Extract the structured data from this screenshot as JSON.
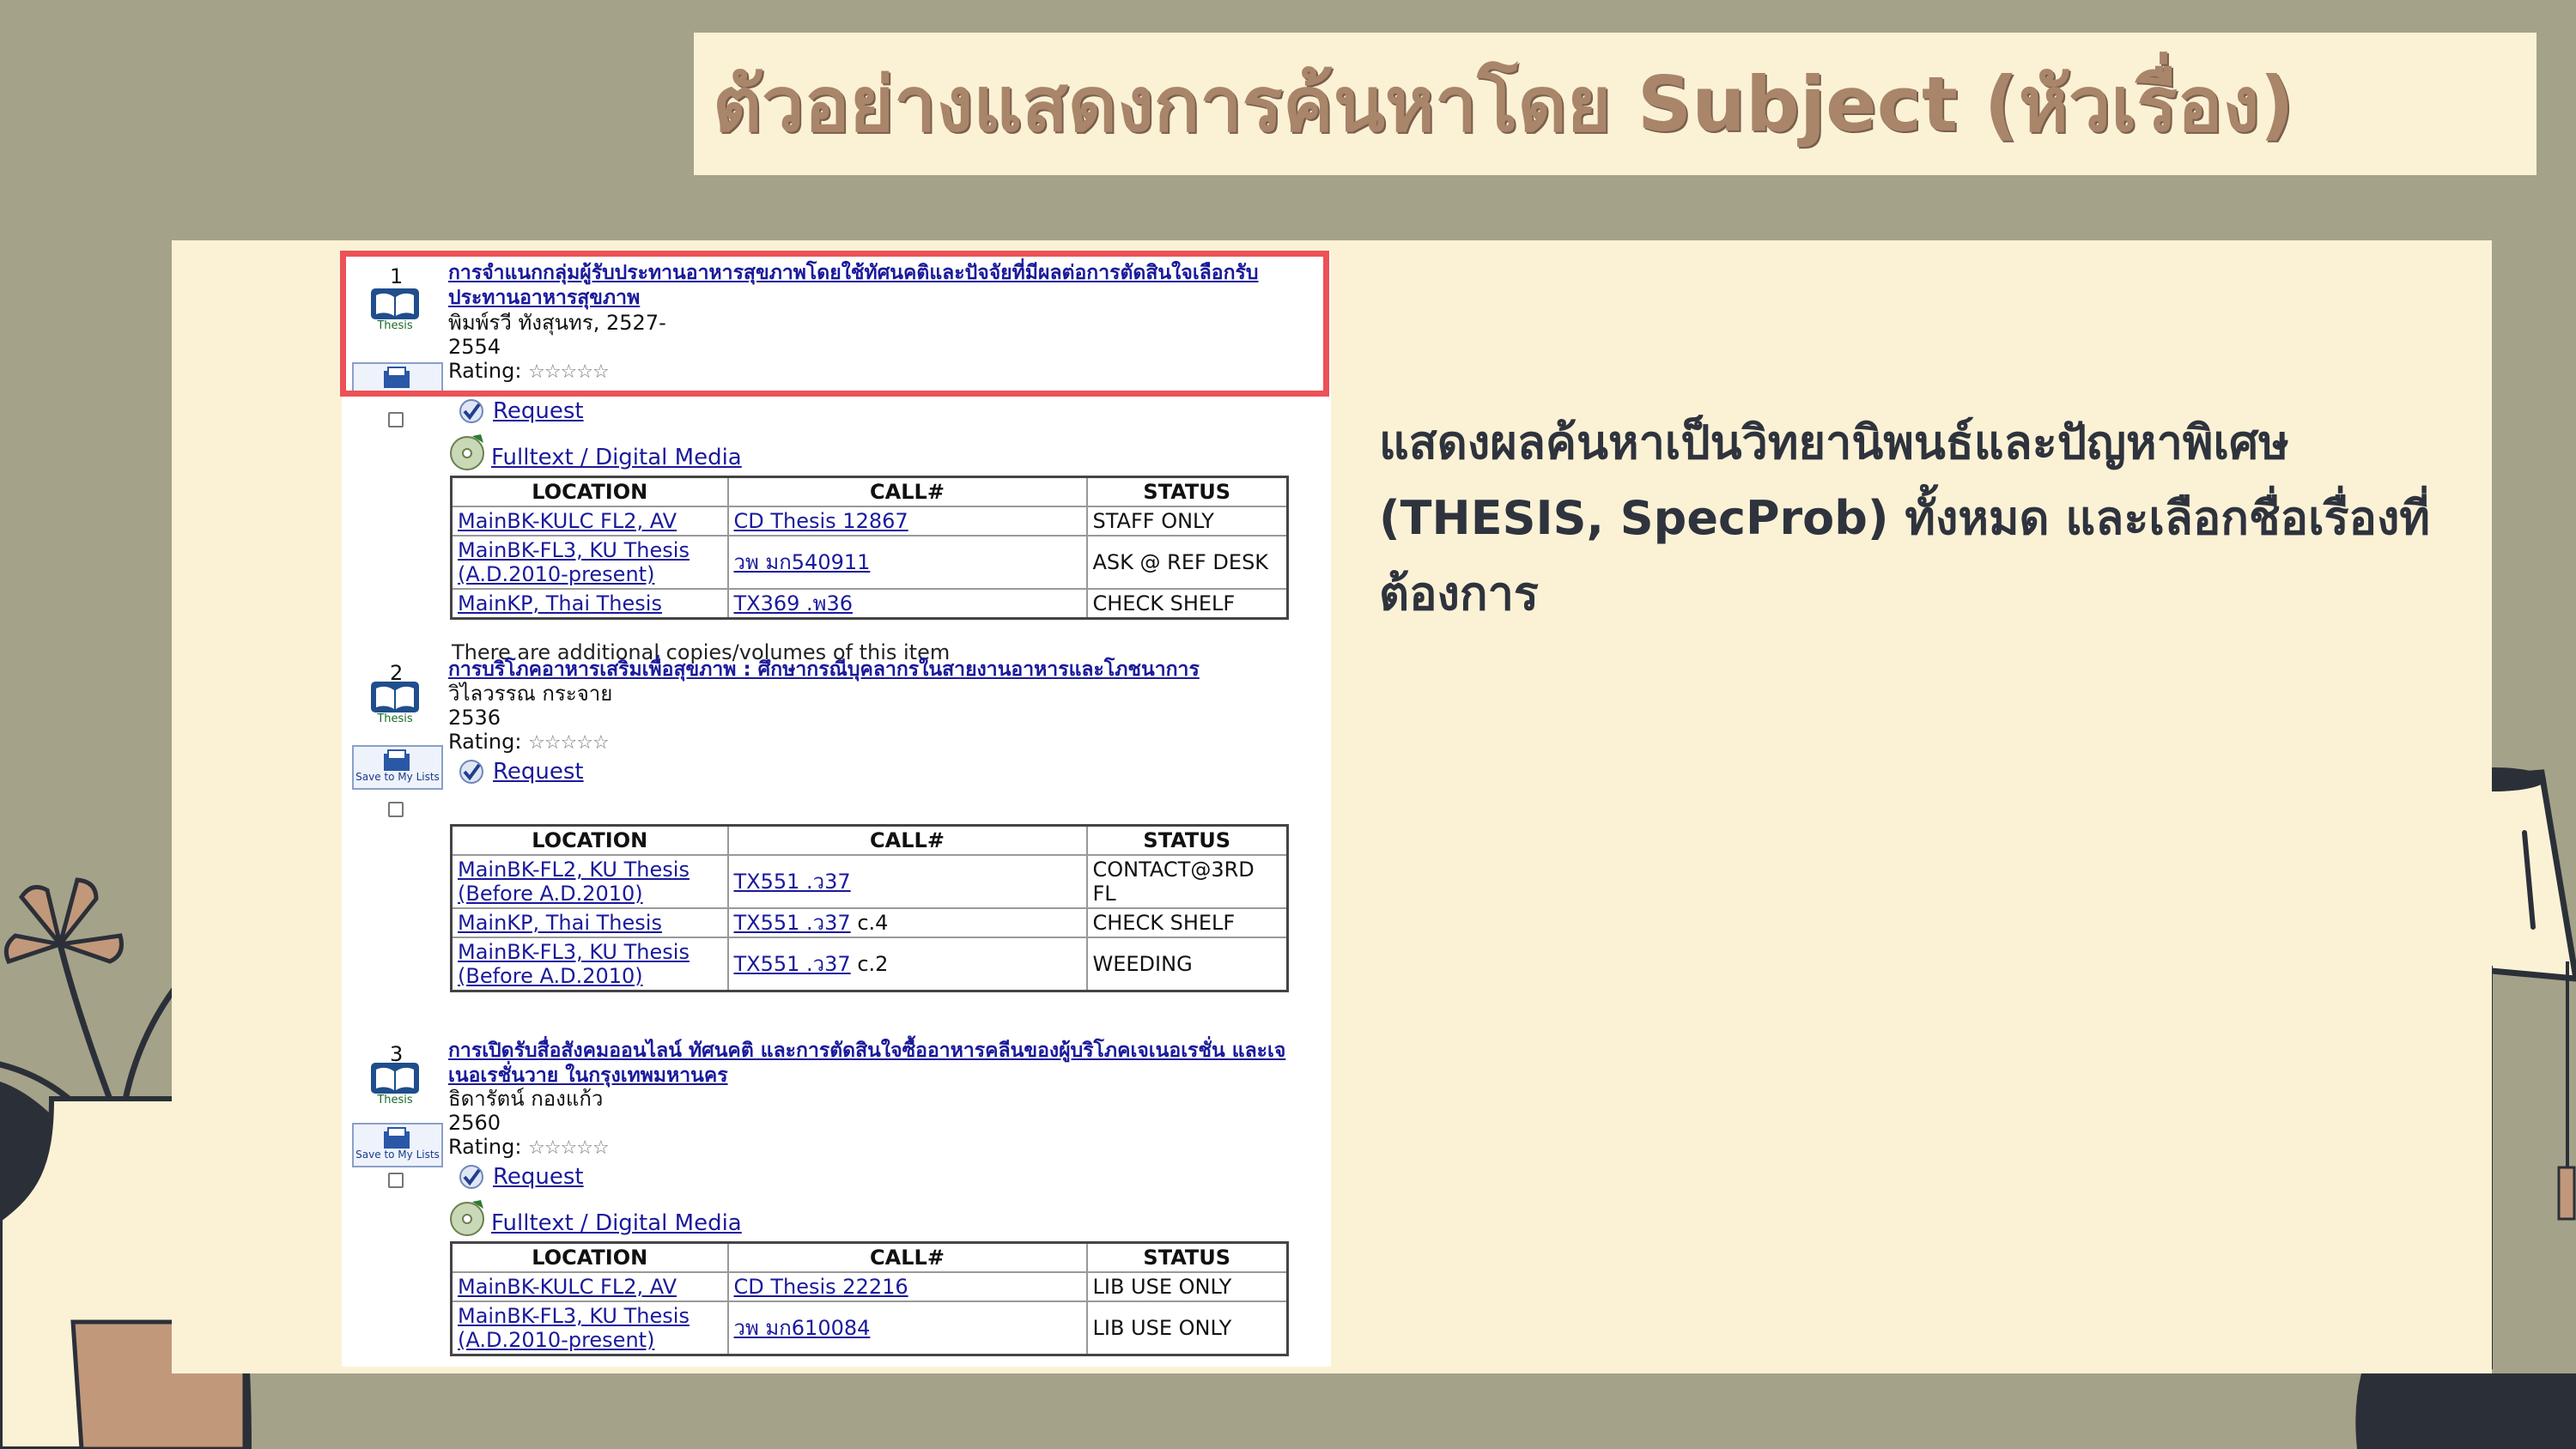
{
  "slide_title": "ตัวอย่างแสดงการค้นหาโดย Subject (หัวเรื่อง)",
  "description": "แสดงผลค้นหาเป็นวิทยานิพนธ์และปัญหาพิเศษ (THESIS, SpecProb) ทั้งหมด และเลือกชื่อเรื่องที่ต้องการ",
  "columns": {
    "location": "LOCATION",
    "call": "CALL#",
    "status": "STATUS"
  },
  "labels": {
    "thesis": "Thesis",
    "save": "Save to My Lists",
    "rating": "Rating:",
    "stars": "☆☆☆☆☆",
    "request": "Request",
    "fulltext": "Fulltext / Digital Media"
  },
  "results": [
    {
      "number": "1",
      "title": "การจำแนกกลุ่มผู้รับประทานอาหารสุขภาพโดยใช้ทัศนคติและปัจจัยที่มีผลต่อการตัดสินใจเลือกรับประทานอาหารสุขภาพ",
      "author": "พิมพ์รวี ทังสุนทร, 2527-",
      "year": "2554",
      "holdings": [
        {
          "location": "MainBK-KULC FL2, AV",
          "call": "CD Thesis 12867",
          "status": "STAFF ONLY"
        },
        {
          "location": "MainBK-FL3, KU Thesis (A.D.2010-present)",
          "call": "วพ มก540911",
          "status": "ASK @ REF DESK"
        },
        {
          "location": "MainKP, Thai Thesis",
          "call": "TX369 .พ36",
          "status": "CHECK SHELF"
        }
      ],
      "note": "There are additional copies/volumes of this item"
    },
    {
      "number": "2",
      "title": "การบริโภคอาหารเสริมเพื่อสุขภาพ : ศึกษากรณีบุคลากรในสายงานอาหารและโภชนาการ",
      "author": "วิไลวรรณ กระจาย",
      "year": "2536",
      "holdings": [
        {
          "location": "MainBK-FL2, KU Thesis (Before A.D.2010)",
          "call": "TX551 .ว37",
          "call_suffix": "",
          "status": "CONTACT@3RD FL"
        },
        {
          "location": "MainKP, Thai Thesis",
          "call": "TX551 .ว37",
          "call_suffix": "c.4",
          "status": "CHECK SHELF"
        },
        {
          "location": "MainBK-FL3, KU Thesis (Before A.D.2010)",
          "call": "TX551 .ว37",
          "call_suffix": "c.2",
          "status": "WEEDING"
        }
      ]
    },
    {
      "number": "3",
      "title": "การเปิดรับสื่อสังคมออนไลน์ ทัศนคติ และการตัดสินใจซื้ออาหารคลีนของผู้บริโภคเจเนอเรชั่น และเจเนอเรชั่นวาย ในกรุงเทพมหานคร",
      "author": "ธิดารัตน์ กองแก้ว",
      "year": "2560",
      "holdings": [
        {
          "location": "MainBK-KULC FL2, AV",
          "call": "CD Thesis 22216",
          "status": "LIB USE ONLY"
        },
        {
          "location": "MainBK-FL3, KU Thesis (A.D.2010-present)",
          "call": "วพ มก610084",
          "status": "LIB USE ONLY"
        }
      ]
    }
  ],
  "colors": {
    "background": "#a5a28a",
    "panel": "#fbf2d6",
    "highlight": "#ec5157",
    "title": "#a9856a",
    "link": "#1a1a9c"
  }
}
